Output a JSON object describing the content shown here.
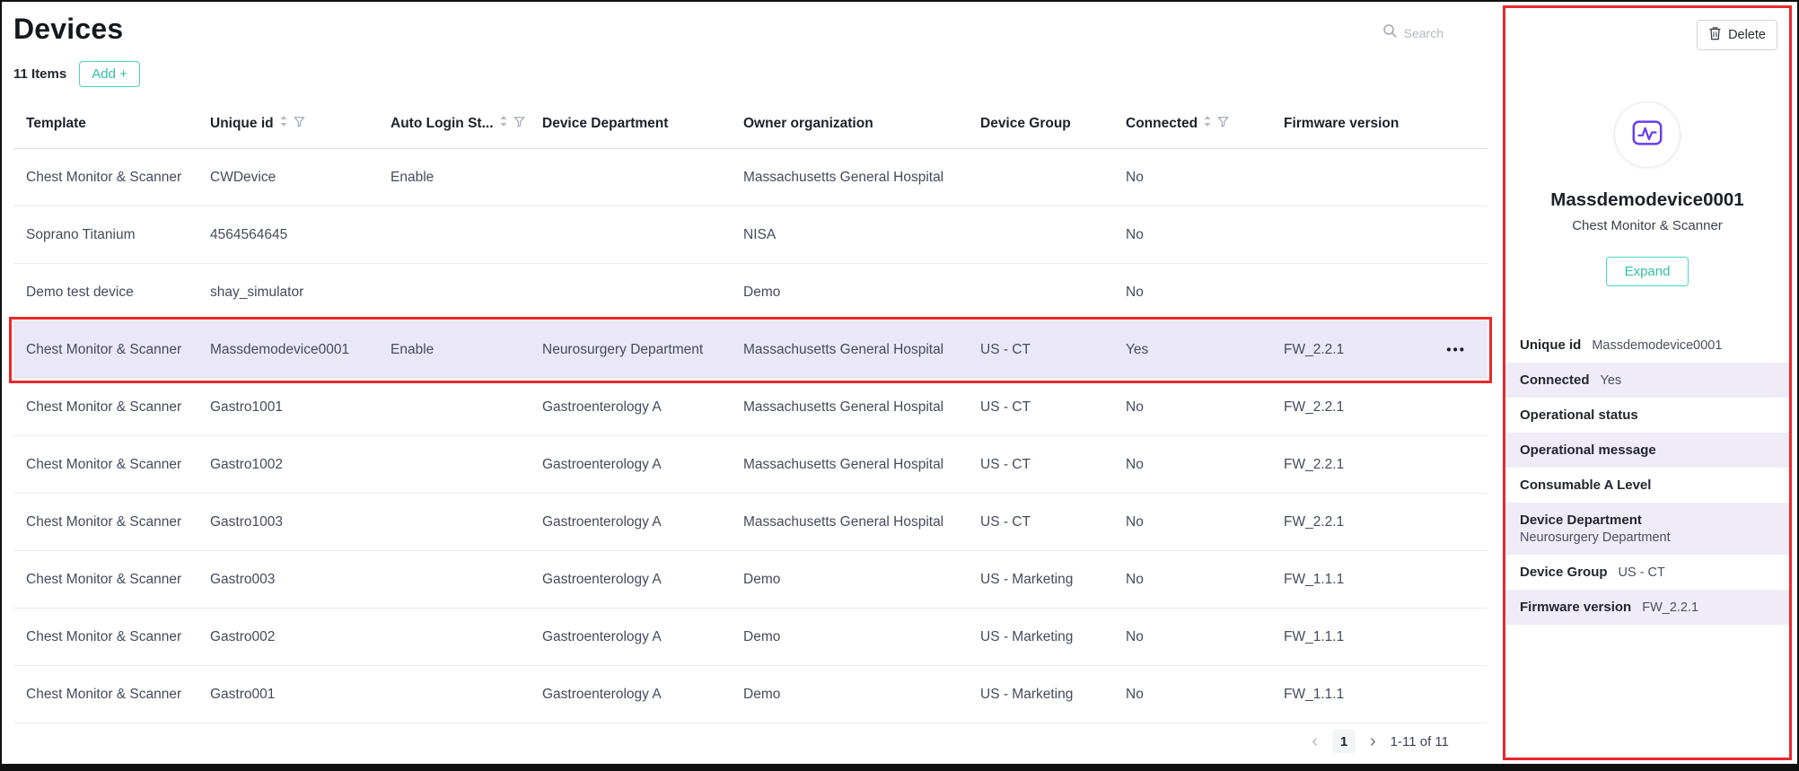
{
  "page": {
    "title": "Devices",
    "items_count": "11 Items",
    "add_button": "Add +",
    "search_placeholder": "Search"
  },
  "table": {
    "columns": [
      {
        "label": "Template",
        "sortable": false,
        "filterable": false
      },
      {
        "label": "Unique id",
        "sortable": true,
        "filterable": true
      },
      {
        "label": "Auto Login St...",
        "sortable": true,
        "filterable": true
      },
      {
        "label": "Device Department",
        "sortable": false,
        "filterable": false
      },
      {
        "label": "Owner organization",
        "sortable": false,
        "filterable": false
      },
      {
        "label": "Device Group",
        "sortable": false,
        "filterable": false
      },
      {
        "label": "Connected",
        "sortable": true,
        "filterable": true
      },
      {
        "label": "Firmware version",
        "sortable": false,
        "filterable": false
      }
    ],
    "rows": [
      [
        "Chest Monitor & Scanner",
        "CWDevice",
        "Enable",
        "",
        "Massachusetts General Hospital",
        "",
        "No",
        ""
      ],
      [
        "Soprano Titanium",
        "4564564645",
        "",
        "",
        "NISA",
        "",
        "No",
        ""
      ],
      [
        "Demo test device",
        "shay_simulator",
        "",
        "",
        "Demo",
        "",
        "No",
        ""
      ],
      [
        "Chest Monitor & Scanner",
        "Massdemodevice0001",
        "Enable",
        "Neurosurgery Department",
        "Massachusetts General Hospital",
        "US - CT",
        "Yes",
        "FW_2.2.1"
      ],
      [
        "Chest Monitor & Scanner",
        "Gastro1001",
        "",
        "Gastroenterology A",
        "Massachusetts General Hospital",
        "US - CT",
        "No",
        "FW_2.2.1"
      ],
      [
        "Chest Monitor & Scanner",
        "Gastro1002",
        "",
        "Gastroenterology A",
        "Massachusetts General Hospital",
        "US - CT",
        "No",
        "FW_2.2.1"
      ],
      [
        "Chest Monitor & Scanner",
        "Gastro1003",
        "",
        "Gastroenterology A",
        "Massachusetts General Hospital",
        "US - CT",
        "No",
        "FW_2.2.1"
      ],
      [
        "Chest Monitor & Scanner",
        "Gastro003",
        "",
        "Gastroenterology A",
        "Demo",
        "US - Marketing",
        "No",
        "FW_1.1.1"
      ],
      [
        "Chest Monitor & Scanner",
        "Gastro002",
        "",
        "Gastroenterology A",
        "Demo",
        "US - Marketing",
        "No",
        "FW_1.1.1"
      ],
      [
        "Chest Monitor & Scanner",
        "Gastro001",
        "",
        "Gastroenterology A",
        "Demo",
        "US - Marketing",
        "No",
        "FW_1.1.1"
      ]
    ],
    "selected_row_index": 3,
    "row_actions_glyph": "•••",
    "pagination": {
      "prev": "‹",
      "page": "1",
      "next": "›",
      "range": "1-11 of 11"
    }
  },
  "detail_panel": {
    "delete_button": "Delete",
    "device_icon": "chest-monitor-icon",
    "device_name": "Massdemodevice0001",
    "device_type": "Chest Monitor & Scanner",
    "expand_button": "Expand",
    "fields": [
      {
        "label": "Unique id",
        "value": "Massdemodevice0001",
        "stacked": false
      },
      {
        "label": "Connected",
        "value": "Yes",
        "stacked": false
      },
      {
        "label": "Operational status",
        "value": "",
        "stacked": false
      },
      {
        "label": "Operational message",
        "value": "",
        "stacked": false
      },
      {
        "label": "Consumable A Level",
        "value": "",
        "stacked": false
      },
      {
        "label": "Device Department",
        "value": "Neurosurgery Department",
        "stacked": true
      },
      {
        "label": "Device Group",
        "value": "US - CT",
        "stacked": false
      },
      {
        "label": "Firmware version",
        "value": "FW_2.2.1",
        "stacked": false
      }
    ]
  },
  "colors": {
    "accent": "#2fbfa8",
    "accent_border": "#49d6bf",
    "selected_row_bg": "#eae7f6",
    "highlight_row_bg": "#efecf7",
    "annotation_red": "#e9282b",
    "icon_purple": "#6a3df2"
  }
}
